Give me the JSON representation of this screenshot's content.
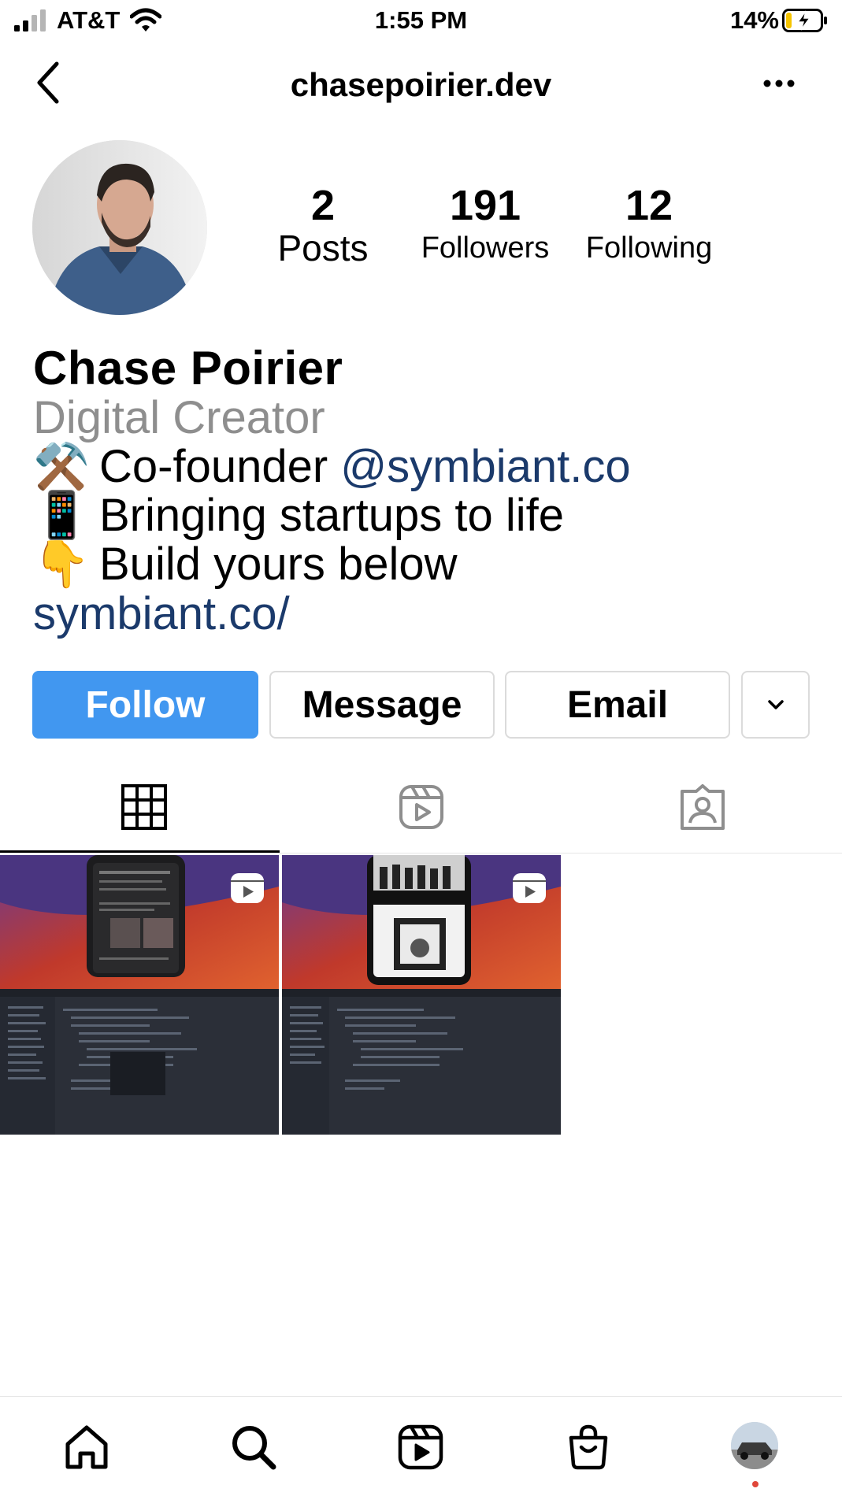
{
  "status_bar": {
    "carrier": "AT&T",
    "time": "1:55 PM",
    "battery_percent": "14%",
    "battery_level": 0.14
  },
  "header": {
    "username": "chasepoirier.dev",
    "back_icon": "chevron-left-icon",
    "more_icon": "more-horizontal-icon"
  },
  "profile": {
    "stats": [
      {
        "value": "2",
        "label": "Posts"
      },
      {
        "value": "191",
        "label": "Followers"
      },
      {
        "value": "12",
        "label": "Following"
      }
    ],
    "name": "Chase Poirier",
    "category": "Digital Creator",
    "bio_lines": [
      {
        "emoji": "⚒️",
        "text": "Co-founder ",
        "mention": "@symbiant.co"
      },
      {
        "emoji": "📱",
        "text": "Bringing startups to life"
      },
      {
        "emoji": "👇",
        "text": "Build yours below"
      }
    ],
    "link": "symbiant.co/"
  },
  "actions": {
    "follow_label": "Follow",
    "message_label": "Message",
    "email_label": "Email",
    "more_icon": "chevron-down-icon",
    "follow_color": "#4197f0"
  },
  "tabs": [
    {
      "icon": "grid-icon",
      "active": true
    },
    {
      "icon": "reels-icon",
      "active": false
    },
    {
      "icon": "tagged-icon",
      "active": false
    }
  ],
  "posts": [
    {
      "type": "reel"
    },
    {
      "type": "reel"
    }
  ],
  "bottom_nav": [
    {
      "icon": "home-icon"
    },
    {
      "icon": "search-icon"
    },
    {
      "icon": "reels-icon"
    },
    {
      "icon": "shop-icon"
    },
    {
      "icon": "profile-avatar"
    }
  ]
}
